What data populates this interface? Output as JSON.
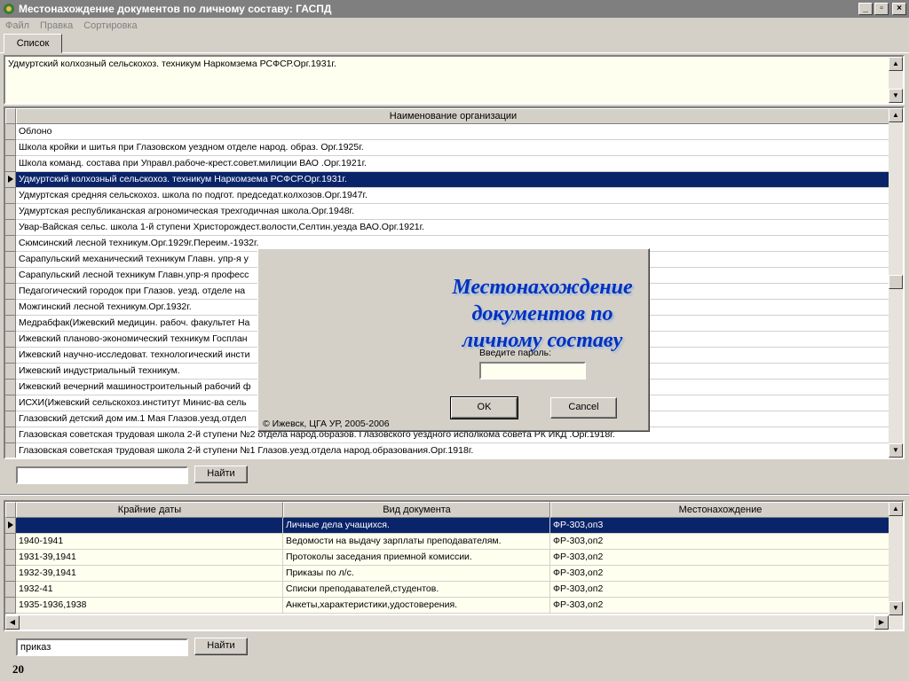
{
  "window": {
    "title": "Местонахождение документов по личному составу: ГАСПД",
    "controls": {
      "minimize": "_",
      "maximize": "▫",
      "close": "×"
    }
  },
  "menu": [
    "Файл",
    "Правка",
    "Сортировка"
  ],
  "tabs": [
    {
      "label": "Список"
    }
  ],
  "memo": {
    "text": "Удмуртский колхозный сельскохоз. техникум Наркомзема РСФСР.Орг.1931г."
  },
  "orgs_grid": {
    "header": "Наименование организации",
    "selected_index": 3,
    "rows": [
      "Облоно",
      "Школа кройки и шитья при Глазовском уездном отделе народ. образ. Орг.1925г.",
      "Школа команд. состава при Управл.рабоче-крест.совет.милиции ВАО .Орг.1921г.",
      "Удмуртский колхозный сельскохоз. техникум Наркомзема РСФСР.Орг.1931г.",
      "Удмуртская средняя сельскохоз. школа по подгот. председат.колхозов.Орг.1947г.",
      "Удмуртская республиканская агрономическая трехгодичная школа.Орг.1948г.",
      "Увар-Вайская сельс. школа 1-й ступени Христорождест.волости,Селтин.уезда ВАО.Орг.1921г.",
      "Сюмсинский лесной техникум.Орг.1929г.Переим.-1932г.",
      "Сарапульский механический техникум Главн. упр-я у",
      "Сарапульский лесной техникум Главн.упр-я професс",
      "Педагогический городок при Глазов. уезд. отделе на",
      "Можгинский лесной техникум.Орг.1932г.",
      "Медрабфак(Ижевский медицин. рабоч. факультет На",
      "Ижевский планово-экономический техникум Госплан",
      "Ижевский научно-исследоват. технологический инсти",
      "Ижевский индустриальный техникум.",
      "Ижевский вечерний машиностроительный рабочий ф",
      "ИСХИ(Ижевский сельскохоз.институт Минис-ва сель",
      "Глазовский детский дом им.1 Мая Глазов.уезд.отдел",
      "Глазовская советская трудовая школа 2-й ступени №2 отдела народ.образов. Глазовского уездного исполкома совета РК ИКД .Орг.1918г.",
      "Глазовская советская трудовая школа 2-й ступени №1 Глазов.уезд.отдела народ.образования.Орг.1918г."
    ]
  },
  "search_top": {
    "value": "",
    "button": "Найти"
  },
  "docs_grid": {
    "headers": [
      "Крайние даты",
      "Вид документа",
      "Местонахождение"
    ],
    "selected_index": 0,
    "rows": [
      [
        "",
        "Личные дела учащихся.",
        "ФР-303,оп3"
      ],
      [
        "1940-1941",
        "Ведомости на выдачу зарплаты преподавателям.",
        "ФР-303,оп2"
      ],
      [
        "1931-39,1941",
        "Протоколы заседания приемной комиссии.",
        "ФР-303,оп2"
      ],
      [
        "1932-39,1941",
        "Приказы по л/с.",
        "ФР-303,оп2"
      ],
      [
        "1932-41",
        "Списки преподавателей,студентов.",
        "ФР-303,оп2"
      ],
      [
        "1935-1936,1938",
        "Анкеты,характеристики,удостоверения.",
        "ФР-303,оп2"
      ]
    ]
  },
  "search_bottom": {
    "value": "приказ",
    "button": "Найти"
  },
  "record_count": "20",
  "dialog": {
    "title_lines": [
      "Местонахождение",
      "документов по",
      "личному составу"
    ],
    "password_label": "Введите пароль:",
    "password_value": "",
    "ok": "OK",
    "cancel": "Cancel",
    "copyright": "© Ижевск, ЦГА УР, 2005-2006"
  }
}
